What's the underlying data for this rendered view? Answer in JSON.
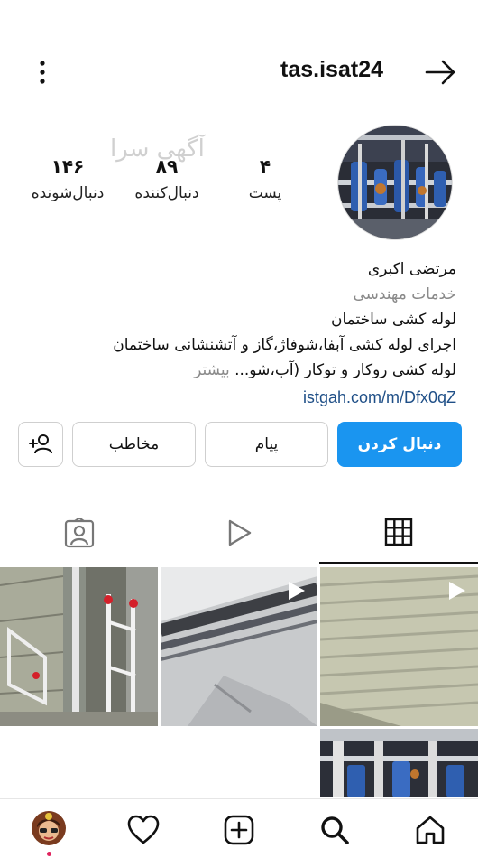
{
  "header": {
    "username": "tas.isat24"
  },
  "watermark": "آگهی سرا",
  "stats": {
    "posts": {
      "value": "۴",
      "label": "پست"
    },
    "followers": {
      "value": "۸۹",
      "label": "دنبال‌کننده"
    },
    "following": {
      "value": "۱۴۶",
      "label": "دنبال‌شونده"
    }
  },
  "bio": {
    "name": "مرتضی اکبری",
    "category": "خدمات مهندسی",
    "lines": [
      "لوله کشی ساختمان",
      "اجرای لوله کشی آبفا،شوفاژ،گاز و آتشنشانی ساختمان",
      "لوله کشی روکار و توکار (آب،شو..."
    ],
    "more_label": "بیشتر",
    "link": "istgah.com/m/Dfx0qZ"
  },
  "buttons": {
    "follow": "دنبال کردن",
    "message": "پیام",
    "contact": "مخاطب"
  },
  "icons": {
    "back": "arrow-right-icon",
    "menu": "more-vertical-icon",
    "add_user": "add-user-icon",
    "grid_tab": "grid-icon",
    "reels_tab": "play-icon",
    "tagged_tab": "tagged-person-icon",
    "home": "home-icon",
    "search": "search-icon",
    "add": "add-post-icon",
    "likes": "heart-icon"
  },
  "colors": {
    "accent": "#1a95f0",
    "link": "#1f4f87",
    "muted": "#8a8a8a",
    "notification_dot": "#e0245e"
  }
}
